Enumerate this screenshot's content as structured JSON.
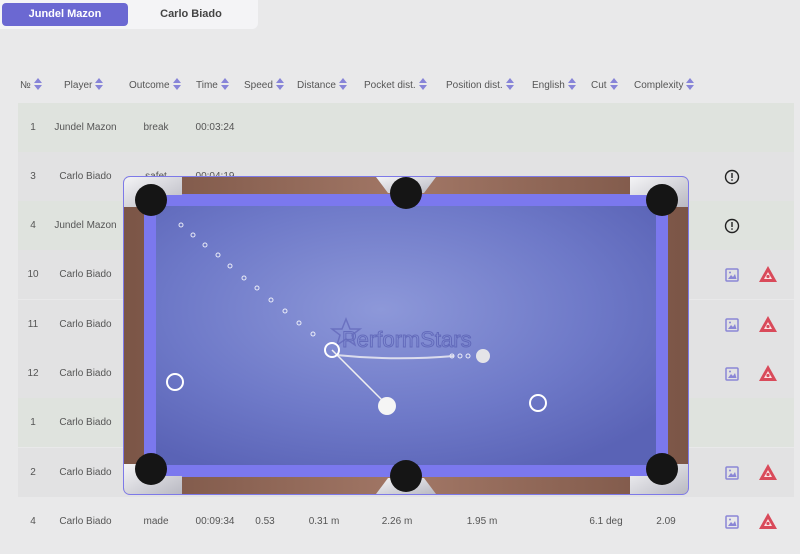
{
  "tabs": [
    {
      "label": "Jundel Mazon",
      "active": true
    },
    {
      "label": "Carlo Biado",
      "active": false
    }
  ],
  "columns": [
    "№",
    "Player",
    "Outcome",
    "Time",
    "Speed",
    "Distance",
    "Pocket dist.",
    "Position dist.",
    "English",
    "Cut",
    "Complexity"
  ],
  "rows": [
    {
      "no": "1",
      "player": "Jundel Mazon",
      "outcome": "break",
      "time": "00:03:24",
      "speed": "",
      "distance": "",
      "pocket": "",
      "position": "",
      "english": "",
      "cut": "",
      "complexity": "",
      "icons": []
    },
    {
      "no": "3",
      "player": "Carlo Biado",
      "outcome": "safet",
      "time": "00:04:19",
      "speed": "",
      "distance": "",
      "pocket": "",
      "position": "",
      "english": "",
      "cut": "",
      "complexity": "",
      "icons": [
        "info"
      ]
    },
    {
      "no": "4",
      "player": "Jundel Mazon",
      "outcome": "",
      "time": "",
      "speed": "",
      "distance": "",
      "pocket": "",
      "position": "",
      "english": "",
      "cut": "",
      "complexity": "",
      "icons": [
        "info"
      ]
    },
    {
      "no": "10",
      "player": "Carlo Biado",
      "outcome": "",
      "time": "",
      "speed": "",
      "distance": "",
      "pocket": "",
      "position": "",
      "english": "",
      "cut": "",
      "complexity": "",
      "icons": [
        "image",
        "warning"
      ]
    },
    {
      "no": "11",
      "player": "Carlo Biado",
      "outcome": "",
      "time": "",
      "speed": "",
      "distance": "",
      "pocket": "",
      "position": "",
      "english": "",
      "cut": "",
      "complexity": "",
      "icons": [
        "image",
        "warning"
      ]
    },
    {
      "no": "12",
      "player": "Carlo Biado",
      "outcome": "",
      "time": "",
      "speed": "",
      "distance": "",
      "pocket": "",
      "position": "",
      "english": "",
      "cut": "",
      "complexity": "",
      "icons": [
        "image",
        "warning"
      ]
    },
    {
      "no": "1",
      "player": "Carlo Biado",
      "outcome": "",
      "time": "",
      "speed": "",
      "distance": "",
      "pocket": "",
      "position": "",
      "english": "",
      "cut": "",
      "complexity": "",
      "icons": []
    },
    {
      "no": "2",
      "player": "Carlo Biado",
      "outcome": "",
      "time": "",
      "speed": "",
      "distance": "",
      "pocket": "",
      "position": "",
      "english": "",
      "cut": "",
      "complexity": "",
      "icons": [
        "image",
        "warning"
      ]
    },
    {
      "no": "4",
      "player": "Carlo Biado",
      "outcome": "made",
      "time": "00:09:34",
      "speed": "0.53",
      "distance": "0.31 m",
      "pocket": "2.26 m",
      "position": "1.95 m",
      "english": "",
      "cut": "6.1 deg",
      "complexity": "2.09",
      "icons": [
        "image",
        "warning"
      ]
    }
  ],
  "table_overlay": {
    "watermark": "PerformStars",
    "cloth_color": "#5f68be",
    "rail_color": "#7b78ee",
    "wood_color": "#8a6150"
  },
  "colors": {
    "accent": "#6b68d2",
    "warning": "#d94a5a",
    "image_icon": "#8a86d6"
  }
}
